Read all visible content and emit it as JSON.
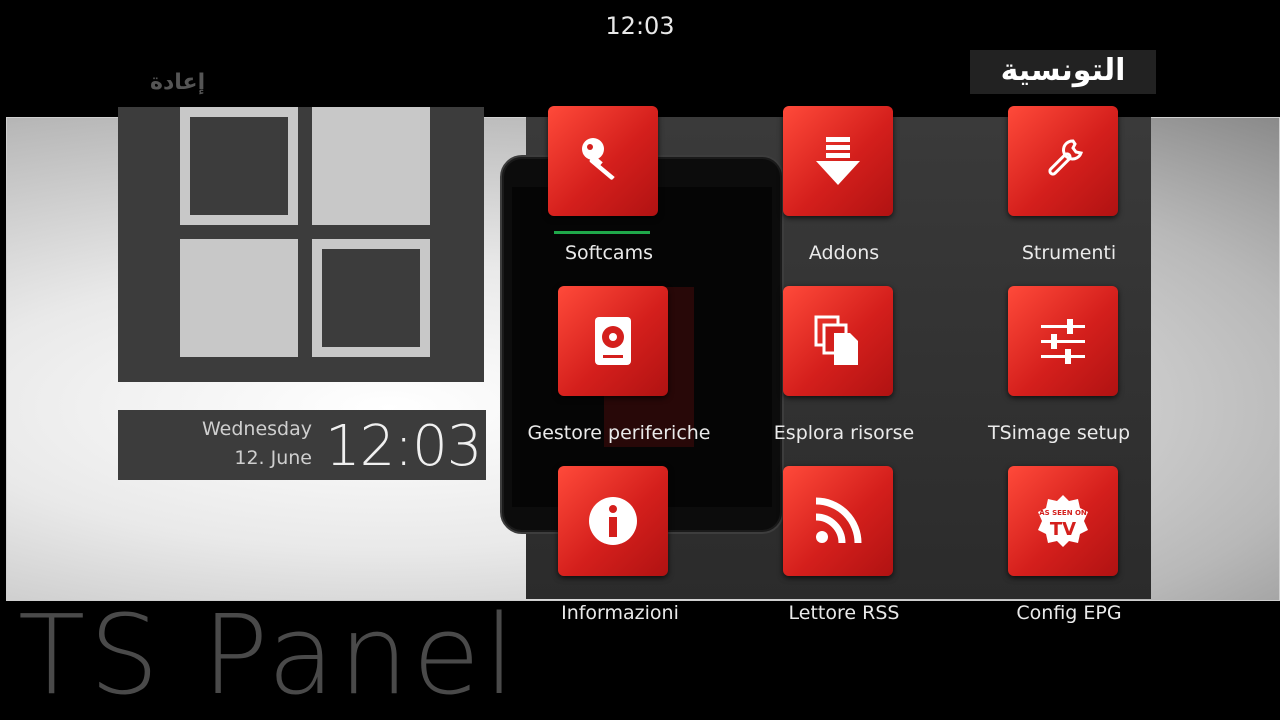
{
  "header": {
    "clock": "12:03"
  },
  "replay_label": "إعادة",
  "channel_logo_text": "التونسية",
  "clock_widget": {
    "weekday": "Wednesday",
    "date": "12. June",
    "time": "12:03"
  },
  "panel_title": "TS Panel",
  "menu": {
    "selected_index": 0,
    "items": [
      {
        "label": "Softcams",
        "icon": "key-icon"
      },
      {
        "label": "Addons",
        "icon": "download-icon"
      },
      {
        "label": "Strumenti",
        "icon": "wrench-icon"
      },
      {
        "label": "Gestore periferiche",
        "icon": "hard-drive-icon"
      },
      {
        "label": "Esplora risorse",
        "icon": "files-icon"
      },
      {
        "label": "TSimage setup",
        "icon": "sliders-icon"
      },
      {
        "label": "Informazioni",
        "icon": "info-icon"
      },
      {
        "label": "Lettore RSS",
        "icon": "rss-icon"
      },
      {
        "label": "Config EPG",
        "icon": "tv-badge-icon",
        "badge_line1": "AS SEEN ON",
        "badge_line2": "TV"
      }
    ]
  },
  "colors": {
    "accent_red": "#d41f1c",
    "focus_green": "#1fa84a",
    "tile_gray": "#c8c8c8",
    "panel_dark": "#3c3c3c"
  }
}
